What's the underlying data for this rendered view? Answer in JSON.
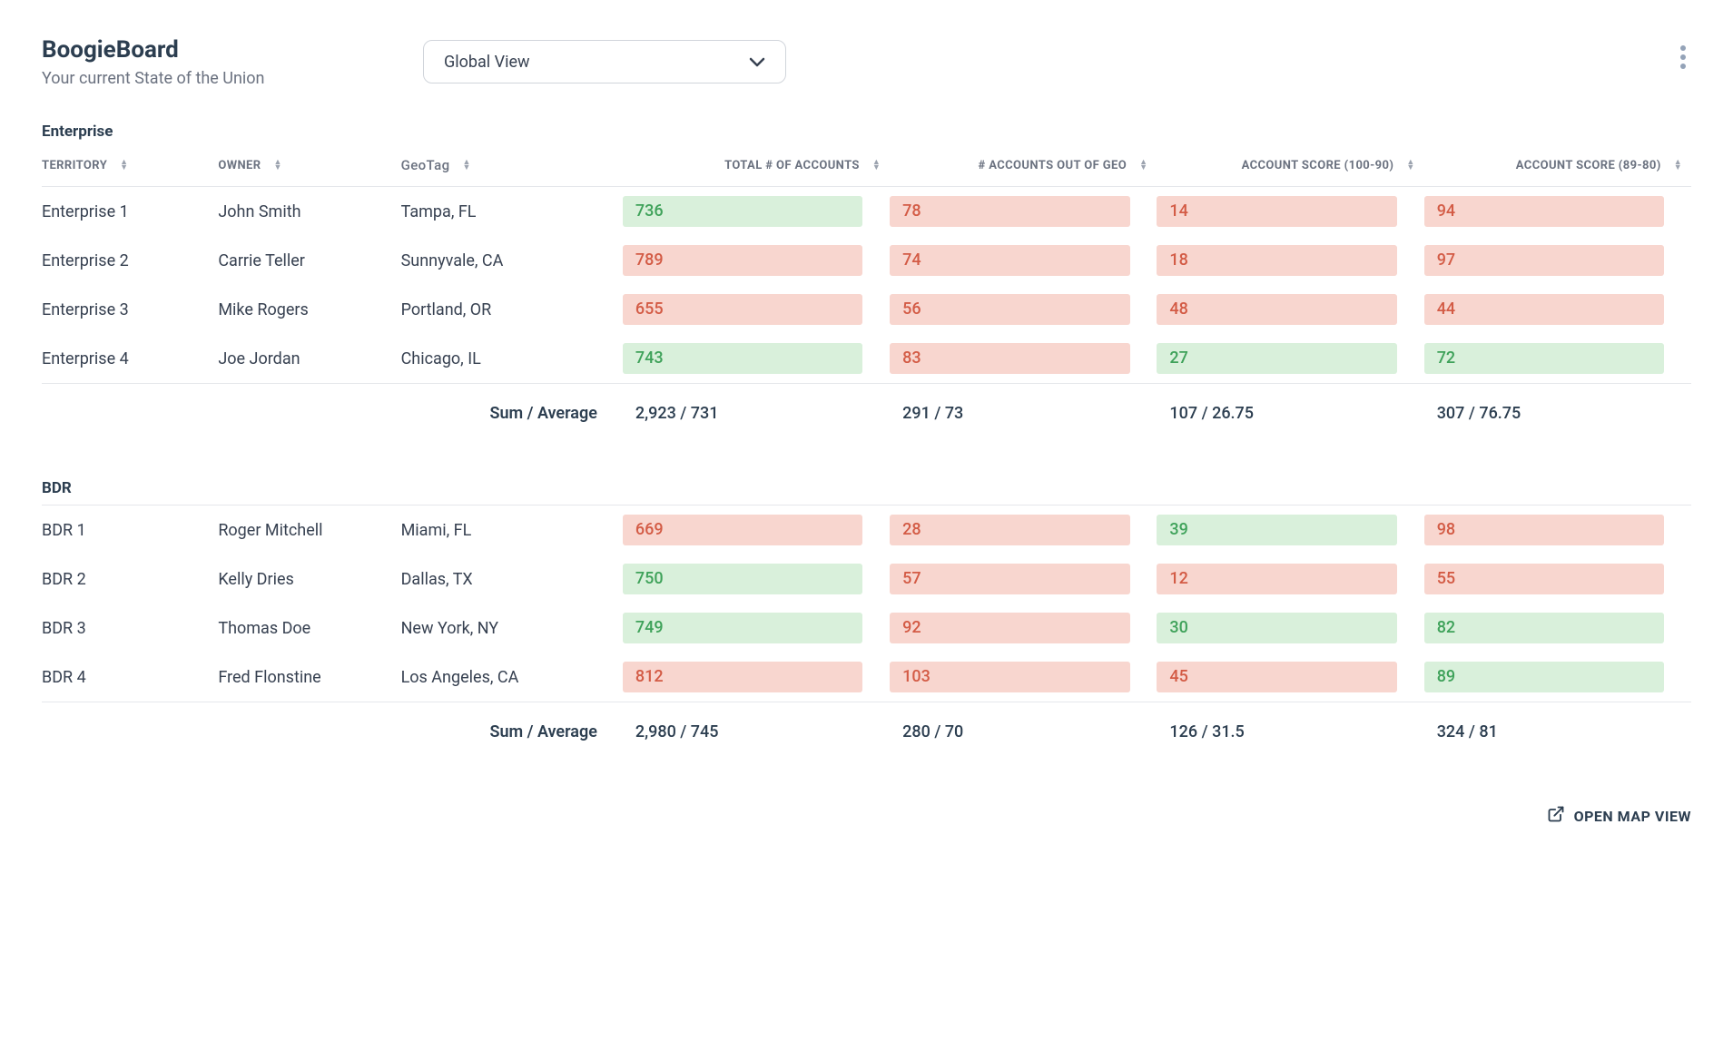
{
  "header": {
    "title": "BoogieBoard",
    "subtitle": "Your current State of the Union",
    "view_selector": "Global View"
  },
  "columns": {
    "territory": "TERRITORY",
    "owner": "OWNER",
    "geotag": "GeoTag",
    "total_accounts": "TOTAL # OF ACCOUNTS",
    "out_of_geo": "# ACCOUNTS OUT OF GEO",
    "score_100_90": "ACCOUNT SCORE (100-90)",
    "score_89_80": "ACCOUNT SCORE (89-80)"
  },
  "sections": {
    "enterprise": {
      "label": "Enterprise",
      "rows": [
        {
          "territory": "Enterprise 1",
          "owner": "John Smith",
          "geo": "Tampa, FL",
          "total": {
            "v": "736",
            "c": "green"
          },
          "out": {
            "v": "78",
            "c": "red"
          },
          "s1": {
            "v": "14",
            "c": "red"
          },
          "s2": {
            "v": "94",
            "c": "red"
          }
        },
        {
          "territory": "Enterprise 2",
          "owner": "Carrie Teller",
          "geo": "Sunnyvale, CA",
          "total": {
            "v": "789",
            "c": "red"
          },
          "out": {
            "v": "74",
            "c": "red"
          },
          "s1": {
            "v": "18",
            "c": "red"
          },
          "s2": {
            "v": "97",
            "c": "red"
          }
        },
        {
          "territory": "Enterprise 3",
          "owner": "Mike Rogers",
          "geo": "Portland, OR",
          "total": {
            "v": "655",
            "c": "red"
          },
          "out": {
            "v": "56",
            "c": "red"
          },
          "s1": {
            "v": "48",
            "c": "red"
          },
          "s2": {
            "v": "44",
            "c": "red"
          }
        },
        {
          "territory": "Enterprise 4",
          "owner": "Joe Jordan",
          "geo": "Chicago, IL",
          "total": {
            "v": "743",
            "c": "green"
          },
          "out": {
            "v": "83",
            "c": "red"
          },
          "s1": {
            "v": "27",
            "c": "green"
          },
          "s2": {
            "v": "72",
            "c": "green"
          }
        }
      ],
      "summary": {
        "label": "Sum / Average",
        "total": "2,923 / 731",
        "out": "291 / 73",
        "s1": "107 / 26.75",
        "s2": "307 / 76.75"
      }
    },
    "bdr": {
      "label": "BDR",
      "rows": [
        {
          "territory": "BDR 1",
          "owner": "Roger Mitchell",
          "geo": "Miami, FL",
          "total": {
            "v": "669",
            "c": "red"
          },
          "out": {
            "v": "28",
            "c": "red"
          },
          "s1": {
            "v": "39",
            "c": "green"
          },
          "s2": {
            "v": "98",
            "c": "red"
          }
        },
        {
          "territory": "BDR 2",
          "owner": "Kelly Dries",
          "geo": "Dallas, TX",
          "total": {
            "v": "750",
            "c": "green"
          },
          "out": {
            "v": "57",
            "c": "red"
          },
          "s1": {
            "v": "12",
            "c": "red"
          },
          "s2": {
            "v": "55",
            "c": "red"
          }
        },
        {
          "territory": "BDR 3",
          "owner": "Thomas Doe",
          "geo": "New York, NY",
          "total": {
            "v": "749",
            "c": "green"
          },
          "out": {
            "v": "92",
            "c": "red"
          },
          "s1": {
            "v": "30",
            "c": "green"
          },
          "s2": {
            "v": "82",
            "c": "green"
          }
        },
        {
          "territory": "BDR 4",
          "owner": "Fred Flonstine",
          "geo": "Los Angeles, CA",
          "total": {
            "v": "812",
            "c": "red"
          },
          "out": {
            "v": "103",
            "c": "red"
          },
          "s1": {
            "v": "45",
            "c": "red"
          },
          "s2": {
            "v": "89",
            "c": "green"
          }
        }
      ],
      "summary": {
        "label": "Sum / Average",
        "total": "2,980 / 745",
        "out": "280 / 70",
        "s1": "126 / 31.5",
        "s2": "324 / 81"
      }
    }
  },
  "footer": {
    "open_map": "OPEN MAP VIEW"
  }
}
